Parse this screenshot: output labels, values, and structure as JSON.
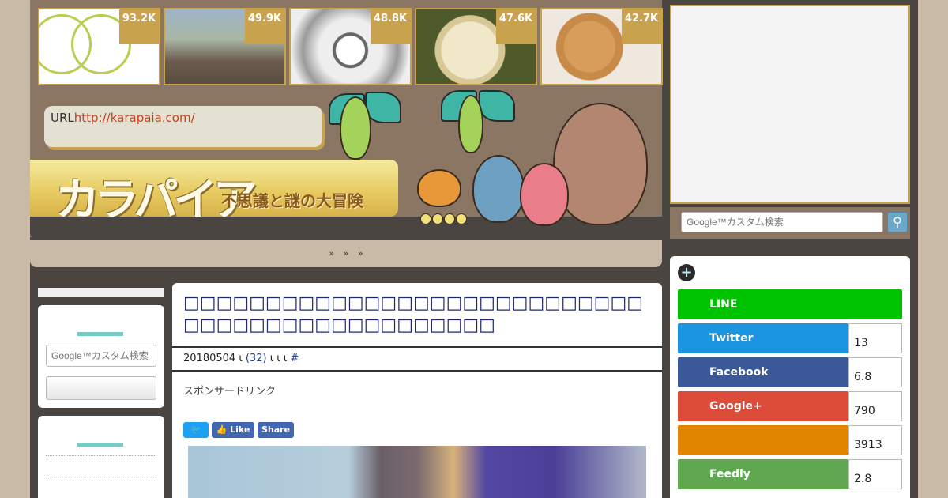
{
  "thumbnails": [
    {
      "count": "93.2K"
    },
    {
      "count": "49.9K"
    },
    {
      "count": "48.8K"
    },
    {
      "count": "47.6K"
    },
    {
      "count": "42.7K"
    }
  ],
  "header": {
    "url_label": "URL",
    "url_link": "http://karapaia.com/",
    "logo_text": "カラパイア",
    "logo_sub": "不思議と謎の大冒険"
  },
  "search": {
    "placeholder": "Google™カスタム検索",
    "button_icon": "search-icon"
  },
  "breadcrumb": {
    "text": "» » »"
  },
  "left_sidebar": {
    "search_placeholder": "Google™カスタム検索"
  },
  "article": {
    "title": "□□□□□□□□□□□□□□□□□□□□□□□□□□□□□□□□□□□□□□□□□□□□□□□",
    "date": "20180504",
    "meta_a": "ι",
    "comment_count": "(32)",
    "meta_b": "ι ι ι",
    "hash": "#",
    "sponsor_label": "スポンサードリンク",
    "share_twitter": "🐦",
    "share_like": "Like",
    "share_share": "Share"
  },
  "social": [
    {
      "name": "LINE",
      "count": "",
      "color": "#00c300"
    },
    {
      "name": "Twitter",
      "count": "13",
      "color": "#1b95e0"
    },
    {
      "name": "Facebook",
      "count": "6.8",
      "color": "#3b5998"
    },
    {
      "name": "Google+",
      "count": "790",
      "color": "#dd4b39"
    },
    {
      "name": "",
      "count": "3913",
      "color": "#e08400"
    },
    {
      "name": "Feedly",
      "count": "2.8",
      "color": "#5fa84f"
    }
  ],
  "colors": {
    "page_bg": "#c9b9a7",
    "header_brown": "#8a7662",
    "gold": "#c8a24d",
    "title_navy": "#1f2a6e"
  }
}
